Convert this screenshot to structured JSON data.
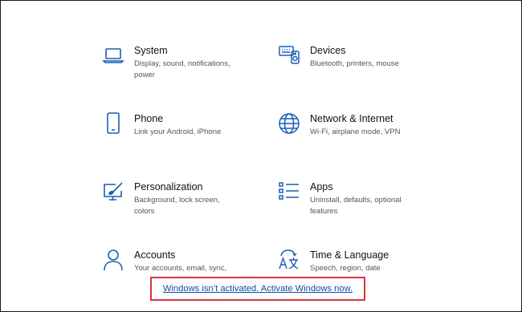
{
  "tiles": [
    {
      "key": "system",
      "title": "System",
      "desc": "Display, sound, notifications, power",
      "icon": "laptop-icon"
    },
    {
      "key": "devices",
      "title": "Devices",
      "desc": "Bluetooth, printers, mouse",
      "icon": "devices-icon"
    },
    {
      "key": "phone",
      "title": "Phone",
      "desc": "Link your Android, iPhone",
      "icon": "phone-icon"
    },
    {
      "key": "network",
      "title": "Network & Internet",
      "desc": "Wi-Fi, airplane mode, VPN",
      "icon": "globe-icon"
    },
    {
      "key": "personalization",
      "title": "Personalization",
      "desc": "Background, lock screen, colors",
      "icon": "paint-icon"
    },
    {
      "key": "apps",
      "title": "Apps",
      "desc": "Uninstall, defaults, optional features",
      "icon": "apps-list-icon"
    },
    {
      "key": "accounts",
      "title": "Accounts",
      "desc": "Your accounts, email, sync,",
      "icon": "person-icon"
    },
    {
      "key": "time-language",
      "title": "Time & Language",
      "desc": "Speech, region, date",
      "icon": "language-icon"
    }
  ],
  "activation": {
    "link_text": "Windows isn’t activated. Activate Windows now."
  },
  "colors": {
    "icon_blue": "#1a5fb4",
    "highlight_red": "#d9343b",
    "link_blue": "#0b4ea2"
  }
}
